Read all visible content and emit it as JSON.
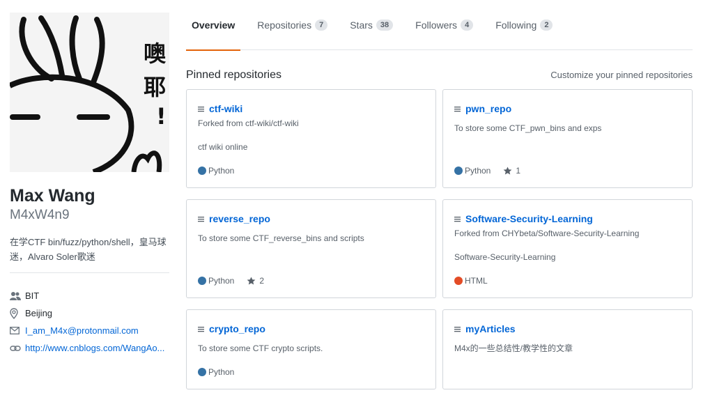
{
  "profile": {
    "fullname": "Max Wang",
    "username": "M4xW4n9",
    "bio": "在学CTF bin/fuzz/python/shell，皇马球迷，Alvaro Soler歌迷",
    "avatar_text": "噢耶！",
    "organization": "BIT",
    "location": "Beijing",
    "email": "I_am_M4x@protonmail.com",
    "website": "http://www.cnblogs.com/WangAo..."
  },
  "tabs": [
    {
      "label": "Overview",
      "count": null
    },
    {
      "label": "Repositories",
      "count": "7"
    },
    {
      "label": "Stars",
      "count": "38"
    },
    {
      "label": "Followers",
      "count": "4"
    },
    {
      "label": "Following",
      "count": "2"
    }
  ],
  "pinned": {
    "title": "Pinned repositories",
    "customize_label": "Customize your pinned repositories",
    "repos": [
      {
        "name": "ctf-wiki",
        "forked_from": "Forked from ctf-wiki/ctf-wiki",
        "description": "ctf wiki online",
        "language": "Python",
        "language_color": "#3572A5",
        "stars": ""
      },
      {
        "name": "pwn_repo",
        "forked_from": "",
        "description": "To store some CTF_pwn_bins and exps",
        "language": "Python",
        "language_color": "#3572A5",
        "stars": "1"
      },
      {
        "name": "reverse_repo",
        "forked_from": "",
        "description": "To store some CTF_reverse_bins and scripts",
        "language": "Python",
        "language_color": "#3572A5",
        "stars": "2"
      },
      {
        "name": "Software-Security-Learning",
        "forked_from": "Forked from CHYbeta/Software-Security-Learning",
        "description": "Software-Security-Learning",
        "language": "HTML",
        "language_color": "#e34c26",
        "stars": ""
      },
      {
        "name": "crypto_repo",
        "forked_from": "",
        "description": "To store some CTF crypto scripts.",
        "language": "Python",
        "language_color": "#3572A5",
        "stars": ""
      },
      {
        "name": "myArticles",
        "forked_from": "",
        "description": "M4x的一些总结性/教学性的文章",
        "language": "",
        "language_color": "",
        "stars": ""
      }
    ]
  },
  "icons": {
    "organization": "people-icon",
    "location": "location-pin-icon",
    "email": "mail-icon",
    "website": "link-icon",
    "repo": "repo-icon",
    "star": "star-icon"
  }
}
